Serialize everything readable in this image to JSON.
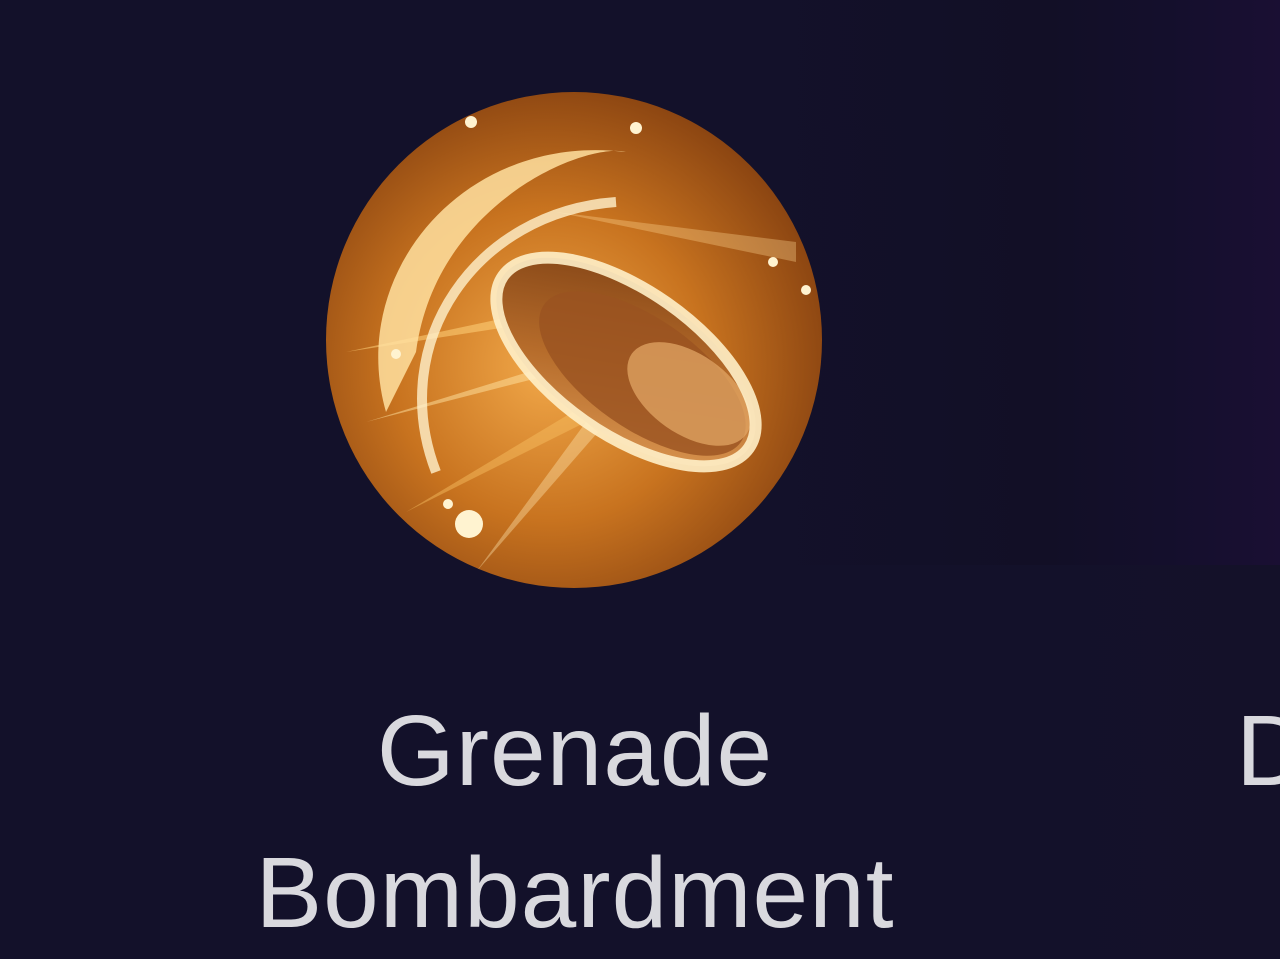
{
  "skills": [
    {
      "name_line1": "Grenade",
      "name_line2": "Bombardment",
      "icon": "grenade-shell-icon",
      "colors": {
        "icon_dark": "#5a2a0a",
        "icon_mid": "#b8661f",
        "icon_light": "#f6c36a",
        "icon_highlight": "#fff3d0"
      }
    },
    {
      "name_partial": "D"
    }
  ],
  "colors": {
    "background": "#13112a",
    "text": "#d9d9de"
  }
}
